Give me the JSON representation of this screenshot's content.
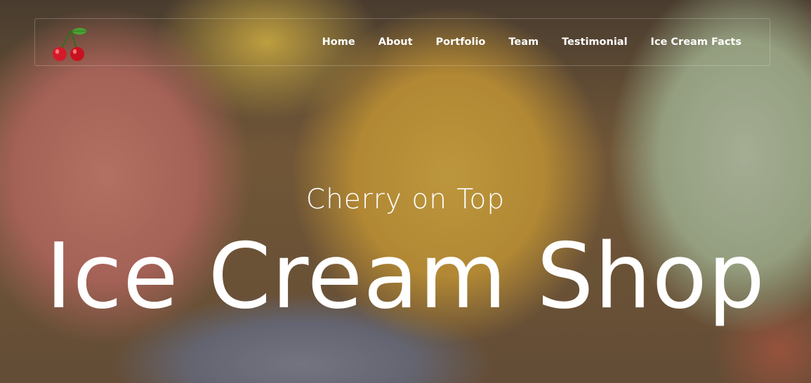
{
  "header": {
    "logo_icon": "cherry-icon",
    "nav": [
      {
        "label": "Home"
      },
      {
        "label": "About"
      },
      {
        "label": "Portfolio"
      },
      {
        "label": "Team"
      },
      {
        "label": "Testimonial"
      },
      {
        "label": "Ice Cream Facts"
      }
    ]
  },
  "hero": {
    "subtitle": "Cherry on Top",
    "title": "Ice Cream Shop",
    "background": "ice-cream-scoops-photo"
  },
  "colors": {
    "text": "#ffffff",
    "cherry_red": "#d41a2a",
    "leaf_green": "#4aa035"
  }
}
